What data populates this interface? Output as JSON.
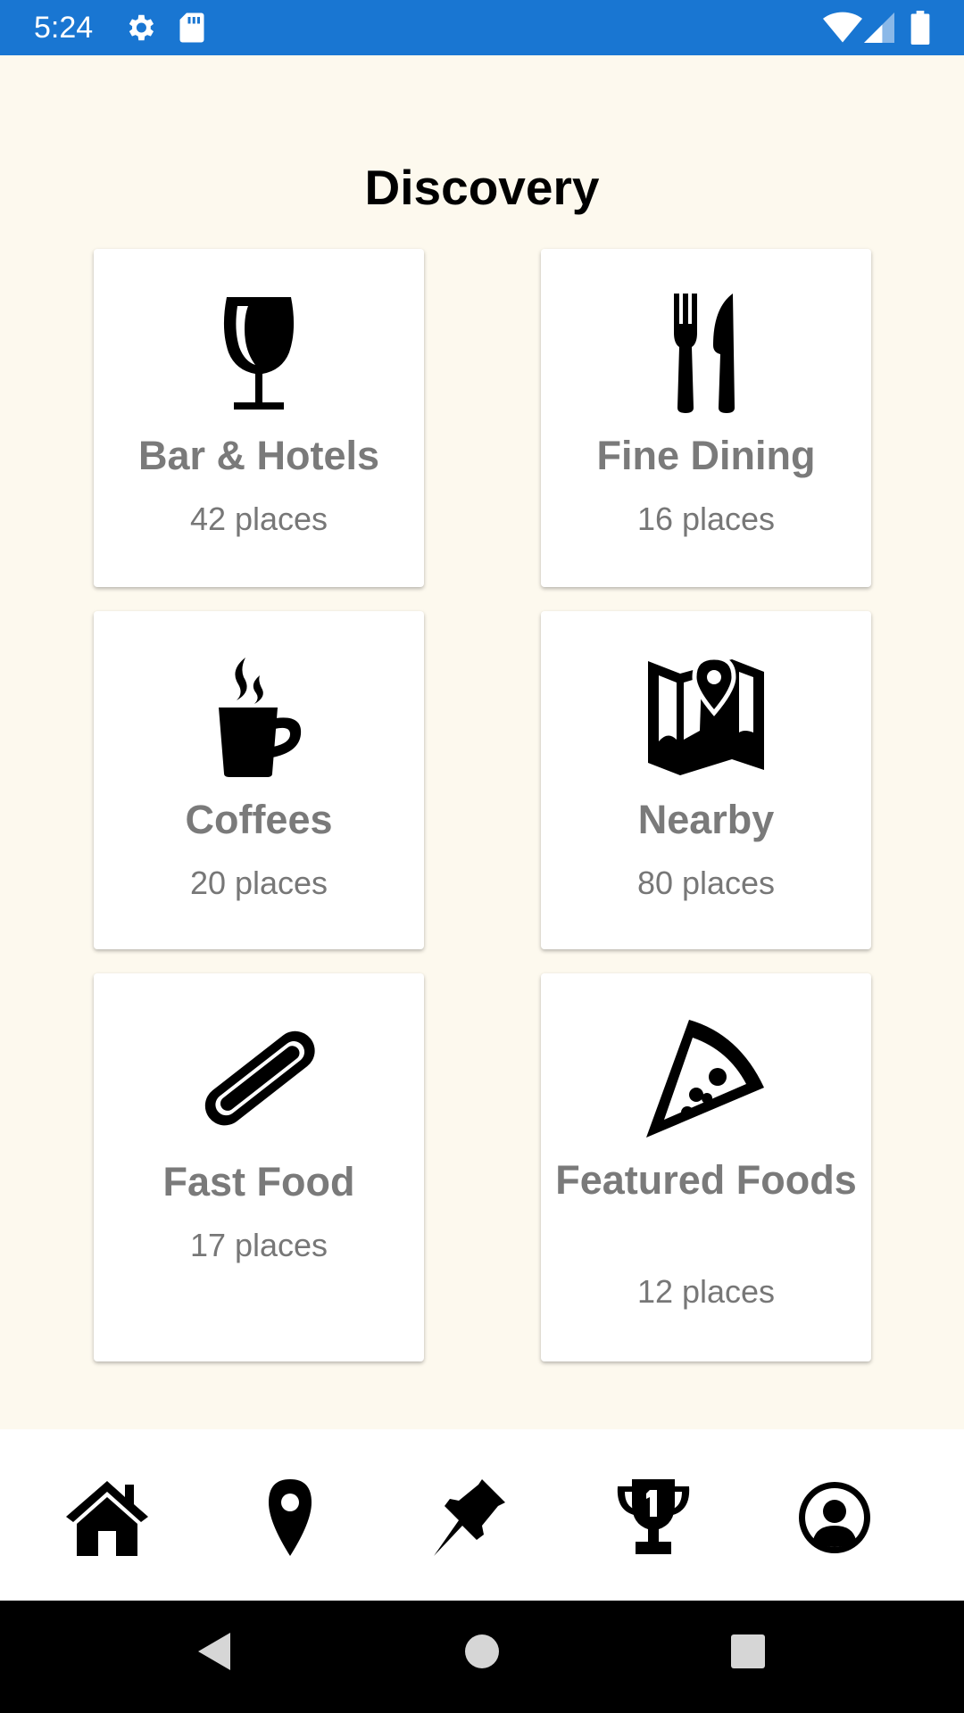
{
  "status_bar": {
    "time": "5:24",
    "icons": [
      "gear-icon",
      "sd-card-icon",
      "wifi-icon",
      "signal-icon",
      "battery-icon"
    ]
  },
  "page_title": "Discovery",
  "categories": [
    {
      "icon": "wine-glass-icon",
      "name": "Bar & Hotels",
      "count": "42 places"
    },
    {
      "icon": "fork-knife-icon",
      "name": "Fine Dining",
      "count": "16 places"
    },
    {
      "icon": "coffee-mug-icon",
      "name": "Coffees",
      "count": "20 places"
    },
    {
      "icon": "map-pin-icon",
      "name": "Nearby",
      "count": "80 places"
    },
    {
      "icon": "hotdog-icon",
      "name": "Fast Food",
      "count": "17 places"
    },
    {
      "icon": "pizza-slice-icon",
      "name": "Featured Foods",
      "count": "12 places"
    }
  ],
  "bottom_nav": [
    "home-icon",
    "location-pin-icon",
    "pushpin-icon",
    "trophy-icon",
    "profile-icon"
  ],
  "colors": {
    "status_bar": "#1976d2",
    "background": "#fdf9ee",
    "card": "#ffffff",
    "label": "#7a7a7a"
  }
}
